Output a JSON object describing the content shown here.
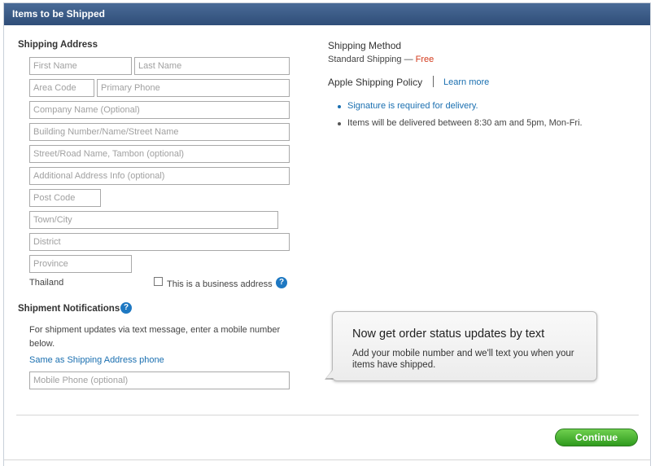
{
  "header": {
    "title": "Items to be Shipped"
  },
  "shipping_address": {
    "heading": "Shipping Address",
    "first_name_placeholder": "First Name",
    "last_name_placeholder": "Last Name",
    "area_code_placeholder": "Area Code",
    "primary_phone_placeholder": "Primary Phone",
    "company_placeholder": "Company Name (Optional)",
    "building_placeholder": "Building Number/Name/Street Name",
    "street_placeholder": "Street/Road Name, Tambon (optional)",
    "additional_placeholder": "Additional Address Info (optional)",
    "post_code_placeholder": "Post Code",
    "town_placeholder": "Town/City",
    "district_placeholder": "District",
    "province_placeholder": "Province",
    "country": "Thailand",
    "business_checkbox_label": "This is a business address",
    "business_checked": false
  },
  "notifications": {
    "heading": "Shipment Notifications",
    "description": "For shipment updates via text message, enter a mobile number below.",
    "same_as_link": "Same as Shipping Address phone",
    "mobile_placeholder": "Mobile Phone (optional)"
  },
  "shipping_method": {
    "heading": "Shipping Method",
    "method": "Standard Shipping —",
    "price": "Free"
  },
  "policy": {
    "heading": "Apple Shipping Policy",
    "learn_more": "Learn more",
    "items": [
      "Signature is required for delivery.",
      "Items will be delivered between 8:30 am and 5pm, Mon-Fri."
    ]
  },
  "callout": {
    "title": "Now get order status updates by text",
    "body": "Add your mobile number and we'll text you when your items have shipped."
  },
  "actions": {
    "continue_label": "Continue"
  },
  "icons": {
    "help": "?"
  },
  "colors": {
    "header": "#2f4d78",
    "link": "#1a6fb0",
    "free": "#d33a1c",
    "continue": "#2f9a1d",
    "help": "#1e78c2"
  }
}
